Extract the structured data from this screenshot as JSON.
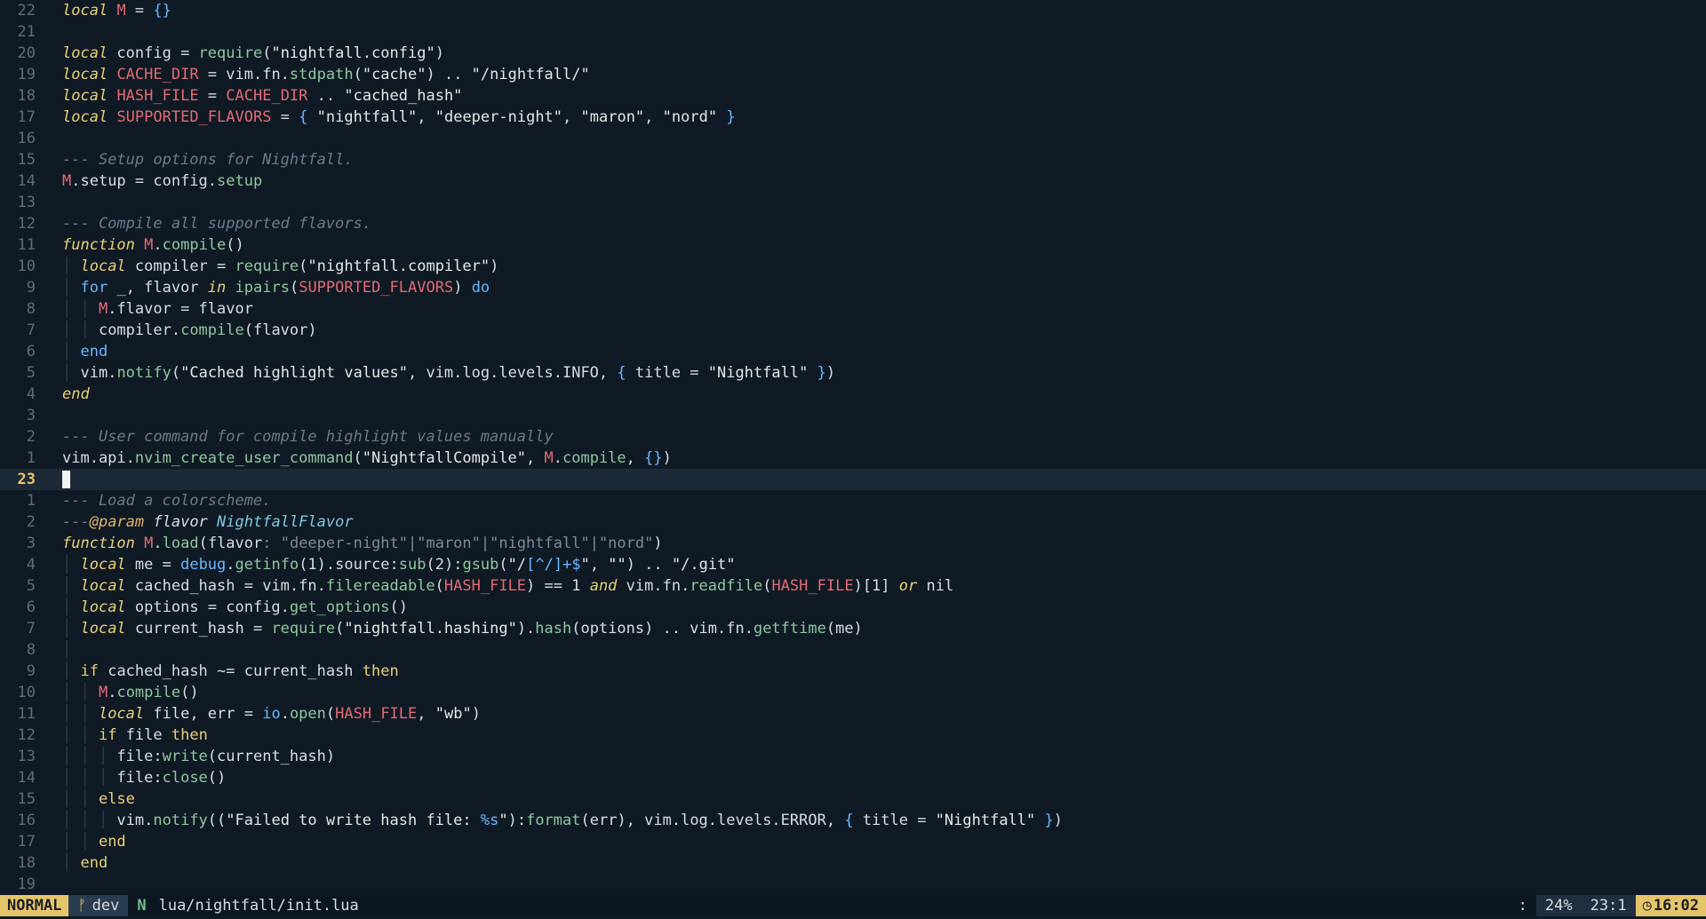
{
  "editor": {
    "lines": [
      {
        "n": "22",
        "segs": [
          [
            "kw",
            "local"
          ],
          [
            "pn",
            " "
          ],
          [
            "const",
            "M"
          ],
          [
            "pn",
            " = "
          ],
          [
            "br",
            "{}"
          ]
        ]
      },
      {
        "n": "21",
        "segs": []
      },
      {
        "n": "20",
        "segs": [
          [
            "kw",
            "local"
          ],
          [
            "pn",
            " config = "
          ],
          [
            "fn",
            "require"
          ],
          [
            "pn",
            "("
          ],
          [
            "str",
            "\"nightfall.config\""
          ],
          [
            "pn",
            ")"
          ]
        ]
      },
      {
        "n": "19",
        "segs": [
          [
            "kw",
            "local"
          ],
          [
            "pn",
            " "
          ],
          [
            "const",
            "CACHE_DIR"
          ],
          [
            "pn",
            " = vim.fn."
          ],
          [
            "fn",
            "stdpath"
          ],
          [
            "pn",
            "("
          ],
          [
            "str",
            "\"cache\""
          ],
          [
            "pn",
            ") .. "
          ],
          [
            "str",
            "\"/nightfall/\""
          ]
        ]
      },
      {
        "n": "18",
        "segs": [
          [
            "kw",
            "local"
          ],
          [
            "pn",
            " "
          ],
          [
            "const",
            "HASH_FILE"
          ],
          [
            "pn",
            " = "
          ],
          [
            "const",
            "CACHE_DIR"
          ],
          [
            "pn",
            " .. "
          ],
          [
            "str",
            "\"cached_hash\""
          ]
        ]
      },
      {
        "n": "17",
        "segs": [
          [
            "kw",
            "local"
          ],
          [
            "pn",
            " "
          ],
          [
            "const",
            "SUPPORTED_FLAVORS"
          ],
          [
            "pn",
            " = "
          ],
          [
            "br",
            "{"
          ],
          [
            "pn",
            " "
          ],
          [
            "str",
            "\"nightfall\""
          ],
          [
            "pn",
            ", "
          ],
          [
            "str",
            "\"deeper-night\""
          ],
          [
            "pn",
            ", "
          ],
          [
            "str",
            "\"maron\""
          ],
          [
            "pn",
            ", "
          ],
          [
            "str",
            "\"nord\""
          ],
          [
            "pn",
            " "
          ],
          [
            "br",
            "}"
          ]
        ]
      },
      {
        "n": "16",
        "segs": []
      },
      {
        "n": "15",
        "segs": [
          [
            "com",
            "--- Setup options for Nightfall."
          ]
        ]
      },
      {
        "n": "14",
        "segs": [
          [
            "const",
            "M"
          ],
          [
            "pn",
            ".setup = config."
          ],
          [
            "fn",
            "setup"
          ]
        ]
      },
      {
        "n": "13",
        "segs": []
      },
      {
        "n": "12",
        "segs": [
          [
            "com",
            "--- Compile all supported flavors."
          ]
        ]
      },
      {
        "n": "11",
        "segs": [
          [
            "kw",
            "function"
          ],
          [
            "pn",
            " "
          ],
          [
            "const",
            "M"
          ],
          [
            "pn",
            "."
          ],
          [
            "fn",
            "compile"
          ],
          [
            "pn",
            "()"
          ]
        ]
      },
      {
        "n": "10",
        "segs": [
          [
            "indent-guide",
            "│ "
          ],
          [
            "kw",
            "local"
          ],
          [
            "pn",
            " compiler = "
          ],
          [
            "fn",
            "require"
          ],
          [
            "pn",
            "("
          ],
          [
            "str",
            "\"nightfall.compiler\""
          ],
          [
            "pn",
            ")"
          ]
        ]
      },
      {
        "n": "9",
        "segs": [
          [
            "indent-guide",
            "│ "
          ],
          [
            "br",
            "for"
          ],
          [
            "pn",
            " _, flavor "
          ],
          [
            "kw",
            "in"
          ],
          [
            "pn",
            " "
          ],
          [
            "fn",
            "ipairs"
          ],
          [
            "pn",
            "("
          ],
          [
            "const",
            "SUPPORTED_FLAVORS"
          ],
          [
            "pn",
            ") "
          ],
          [
            "br",
            "do"
          ]
        ]
      },
      {
        "n": "8",
        "segs": [
          [
            "indent-guide",
            "│ │ "
          ],
          [
            "const",
            "M"
          ],
          [
            "pn",
            ".flavor = flavor"
          ]
        ]
      },
      {
        "n": "7",
        "segs": [
          [
            "indent-guide",
            "│ │ "
          ],
          [
            "pn",
            "compiler."
          ],
          [
            "fn",
            "compile"
          ],
          [
            "pn",
            "(flavor)"
          ]
        ]
      },
      {
        "n": "6",
        "segs": [
          [
            "indent-guide",
            "│ "
          ],
          [
            "br",
            "end"
          ]
        ]
      },
      {
        "n": "5",
        "segs": [
          [
            "indent-guide",
            "│ "
          ],
          [
            "pn",
            "vim."
          ],
          [
            "fn",
            "notify"
          ],
          [
            "pn",
            "("
          ],
          [
            "str",
            "\"Cached highlight values\""
          ],
          [
            "pn",
            ", vim.log.levels.INFO, "
          ],
          [
            "br",
            "{"
          ],
          [
            "pn",
            " title = "
          ],
          [
            "str",
            "\"Nightfall\""
          ],
          [
            "pn",
            " "
          ],
          [
            "br",
            "}"
          ],
          [
            "pn",
            ")"
          ]
        ]
      },
      {
        "n": "4",
        "segs": [
          [
            "kw",
            "end"
          ]
        ]
      },
      {
        "n": "3",
        "segs": []
      },
      {
        "n": "2",
        "segs": [
          [
            "com",
            "--- User command for compile highlight values manually"
          ]
        ]
      },
      {
        "n": "1",
        "segs": [
          [
            "pn",
            "vim.api."
          ],
          [
            "fn",
            "nvim_create_user_command"
          ],
          [
            "pn",
            "("
          ],
          [
            "str",
            "\"NightfallCompile\""
          ],
          [
            "pn",
            ", "
          ],
          [
            "const",
            "M"
          ],
          [
            "pn",
            "."
          ],
          [
            "fn",
            "compile"
          ],
          [
            "pn",
            ", "
          ],
          [
            "br",
            "{}"
          ],
          [
            "pn",
            ")"
          ]
        ]
      },
      {
        "n": "23",
        "segs": [],
        "cursor": true
      },
      {
        "n": "1",
        "segs": [
          [
            "com",
            "--- Load a colorscheme."
          ]
        ]
      },
      {
        "n": "2",
        "segs": [
          [
            "com",
            "---"
          ],
          [
            "ann",
            "@param"
          ],
          [
            "param",
            " flavor "
          ],
          [
            "type",
            "NightfallFlavor"
          ]
        ]
      },
      {
        "n": "3",
        "segs": [
          [
            "kw",
            "function"
          ],
          [
            "pn",
            " "
          ],
          [
            "const",
            "M"
          ],
          [
            "pn",
            "."
          ],
          [
            "fn",
            "load"
          ],
          [
            "pn",
            "(flavor"
          ],
          [
            "dim",
            ": \"deeper-night\"|\"maron\"|\"nightfall\"|\"nord\""
          ],
          [
            "pn",
            ")"
          ]
        ]
      },
      {
        "n": "4",
        "segs": [
          [
            "indent-guide",
            "│ "
          ],
          [
            "kw",
            "local"
          ],
          [
            "pn",
            " me = "
          ],
          [
            "br",
            "debug"
          ],
          [
            "pn",
            "."
          ],
          [
            "fn",
            "getinfo"
          ],
          [
            "pn",
            "(1).source:"
          ],
          [
            "fn",
            "sub"
          ],
          [
            "pn",
            "(2):"
          ],
          [
            "fn",
            "gsub"
          ],
          [
            "pn",
            "("
          ],
          [
            "str",
            "\"/"
          ],
          [
            "br",
            "[^/]+$"
          ],
          [
            "str",
            "\""
          ],
          [
            "pn",
            ", "
          ],
          [
            "str",
            "\"\""
          ],
          [
            "pn",
            ") .. "
          ],
          [
            "str",
            "\"/.git\""
          ]
        ]
      },
      {
        "n": "5",
        "segs": [
          [
            "indent-guide",
            "│ "
          ],
          [
            "kw",
            "local"
          ],
          [
            "pn",
            " cached_hash = vim.fn."
          ],
          [
            "fn",
            "filereadable"
          ],
          [
            "pn",
            "("
          ],
          [
            "const",
            "HASH_FILE"
          ],
          [
            "pn",
            ") == 1 "
          ],
          [
            "kw",
            "and"
          ],
          [
            "pn",
            " vim.fn."
          ],
          [
            "fn",
            "readfile"
          ],
          [
            "pn",
            "("
          ],
          [
            "const",
            "HASH_FILE"
          ],
          [
            "pn",
            ")[1] "
          ],
          [
            "kw",
            "or"
          ],
          [
            "pn",
            " nil"
          ]
        ]
      },
      {
        "n": "6",
        "segs": [
          [
            "indent-guide",
            "│ "
          ],
          [
            "kw",
            "local"
          ],
          [
            "pn",
            " options = config."
          ],
          [
            "fn",
            "get_options"
          ],
          [
            "pn",
            "()"
          ]
        ]
      },
      {
        "n": "7",
        "segs": [
          [
            "indent-guide",
            "│ "
          ],
          [
            "kw",
            "local"
          ],
          [
            "pn",
            " current_hash = "
          ],
          [
            "fn",
            "require"
          ],
          [
            "pn",
            "("
          ],
          [
            "str",
            "\"nightfall.hashing\""
          ],
          [
            "pn",
            ")."
          ],
          [
            "fn",
            "hash"
          ],
          [
            "pn",
            "(options) .. vim.fn."
          ],
          [
            "fn",
            "getftime"
          ],
          [
            "pn",
            "(me)"
          ]
        ]
      },
      {
        "n": "8",
        "segs": [
          [
            "indent-guide",
            "│"
          ]
        ]
      },
      {
        "n": "9",
        "segs": [
          [
            "indent-guide",
            "│ "
          ],
          [
            "kw2",
            "if"
          ],
          [
            "pn",
            " cached_hash ~= current_hash "
          ],
          [
            "kw2",
            "then"
          ]
        ]
      },
      {
        "n": "10",
        "segs": [
          [
            "indent-guide",
            "│ │ "
          ],
          [
            "const",
            "M"
          ],
          [
            "pn",
            "."
          ],
          [
            "fn",
            "compile"
          ],
          [
            "pn",
            "()"
          ]
        ]
      },
      {
        "n": "11",
        "segs": [
          [
            "indent-guide",
            "│ │ "
          ],
          [
            "kw",
            "local"
          ],
          [
            "pn",
            " file, err = "
          ],
          [
            "br",
            "io"
          ],
          [
            "pn",
            "."
          ],
          [
            "fn",
            "open"
          ],
          [
            "pn",
            "("
          ],
          [
            "const",
            "HASH_FILE"
          ],
          [
            "pn",
            ", "
          ],
          [
            "str",
            "\"wb\""
          ],
          [
            "pn",
            ")"
          ]
        ]
      },
      {
        "n": "12",
        "segs": [
          [
            "indent-guide",
            "│ │ "
          ],
          [
            "kw2",
            "if"
          ],
          [
            "pn",
            " file "
          ],
          [
            "kw2",
            "then"
          ]
        ]
      },
      {
        "n": "13",
        "segs": [
          [
            "indent-guide",
            "│ │ │ "
          ],
          [
            "pn",
            "file:"
          ],
          [
            "fn",
            "write"
          ],
          [
            "pn",
            "(current_hash)"
          ]
        ]
      },
      {
        "n": "14",
        "segs": [
          [
            "indent-guide",
            "│ │ │ "
          ],
          [
            "pn",
            "file:"
          ],
          [
            "fn",
            "close"
          ],
          [
            "pn",
            "()"
          ]
        ]
      },
      {
        "n": "15",
        "segs": [
          [
            "indent-guide",
            "│ │ "
          ],
          [
            "kw2",
            "else"
          ]
        ]
      },
      {
        "n": "16",
        "segs": [
          [
            "indent-guide",
            "│ │ │ "
          ],
          [
            "pn",
            "vim."
          ],
          [
            "fn",
            "notify"
          ],
          [
            "pn",
            "(("
          ],
          [
            "str",
            "\"Failed to write hash file: "
          ],
          [
            "br",
            "%s"
          ],
          [
            "str",
            "\""
          ],
          [
            "pn",
            "):"
          ],
          [
            "fn",
            "format"
          ],
          [
            "pn",
            "(err), vim.log.levels.ERROR, "
          ],
          [
            "br",
            "{"
          ],
          [
            "pn",
            " title = "
          ],
          [
            "str",
            "\"Nightfall\""
          ],
          [
            "pn",
            " "
          ],
          [
            "br",
            "}"
          ],
          [
            "pn",
            ")"
          ]
        ]
      },
      {
        "n": "17",
        "segs": [
          [
            "indent-guide",
            "│ │ "
          ],
          [
            "kw2",
            "end"
          ]
        ]
      },
      {
        "n": "18",
        "segs": [
          [
            "indent-guide",
            "│ "
          ],
          [
            "kw2",
            "end"
          ]
        ]
      },
      {
        "n": "19",
        "segs": []
      }
    ]
  },
  "statusline": {
    "mode": "NORMAL",
    "branch_icon": "git-branch-icon",
    "branch": "dev",
    "file_icon": "neovim-icon",
    "file_icon_glyph": "N",
    "file": "lua/nightfall/init.lua",
    "colon": ":",
    "percent": "24%",
    "position": "23:1",
    "clock_icon": "clock-icon",
    "time": "16:02"
  },
  "colors": {
    "background": "#101a24",
    "mode_accent": "#e6c46a",
    "keyword": "#e8d07a",
    "function": "#8fc7a0",
    "constant": "#e06c75",
    "comment": "#6b7b8c"
  }
}
